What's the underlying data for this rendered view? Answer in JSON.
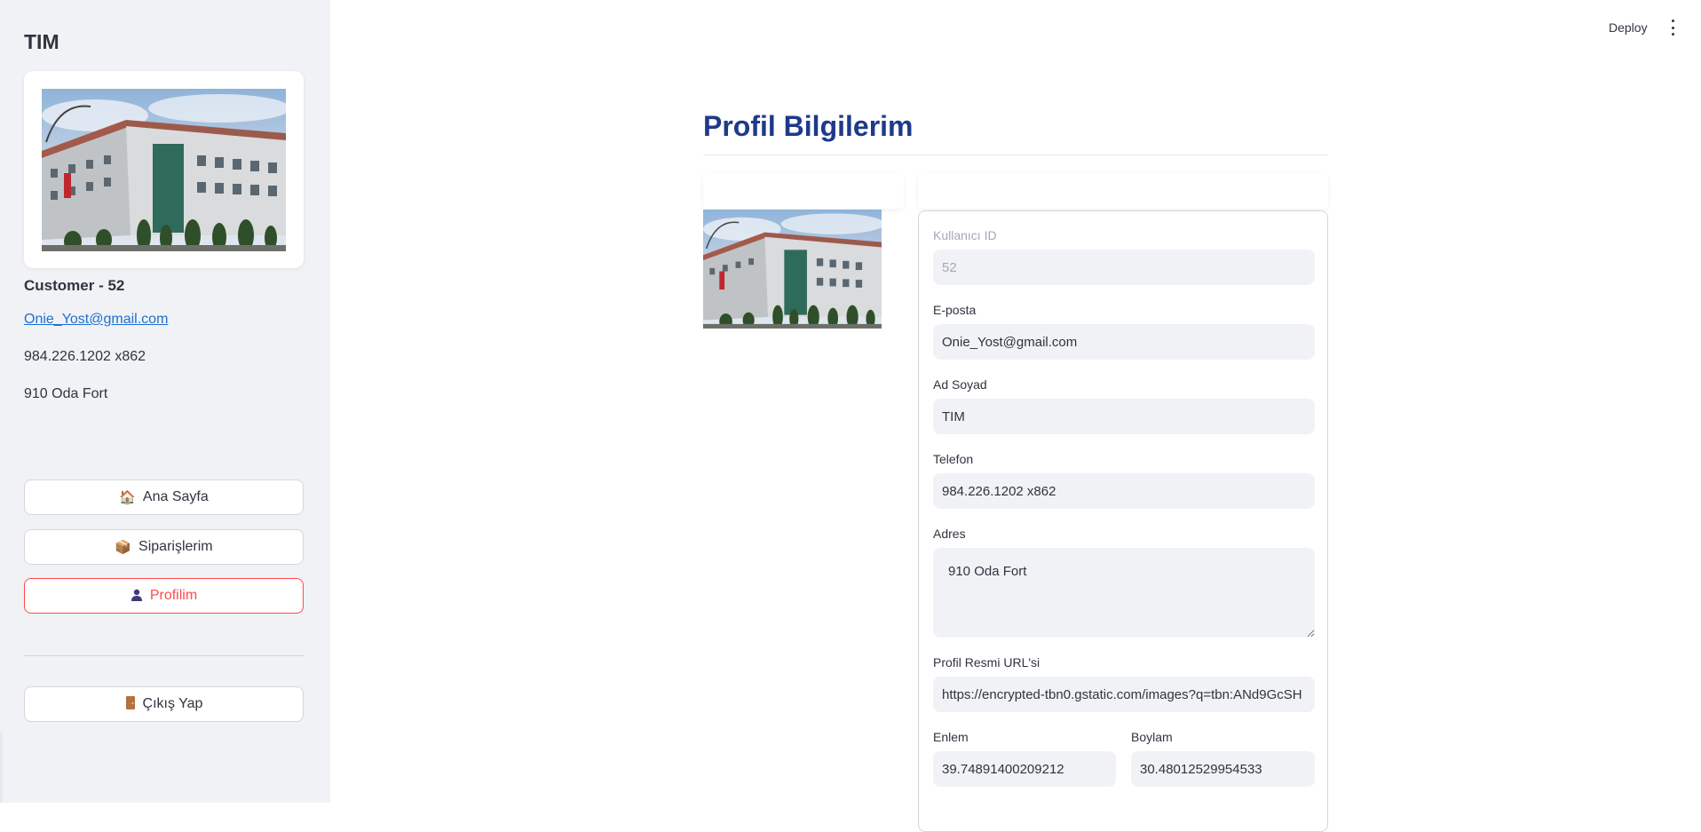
{
  "sidebar": {
    "title": "TIM",
    "customer_label": "Customer - 52",
    "email": "Onie_Yost@gmail.com",
    "phone": "984.226.1202 x862",
    "address": "910 Oda Fort",
    "buttons": [
      {
        "label": "Ana Sayfa",
        "icon": "house-icon"
      },
      {
        "label": "Siparişlerim",
        "icon": "package-icon"
      },
      {
        "label": "Profilim",
        "icon": "user-icon",
        "active": true
      }
    ],
    "logout": {
      "label": "Çıkış Yap",
      "icon": "door-icon"
    }
  },
  "header": {
    "deploy_label": "Deploy",
    "menu_icon": "vertical-dots-icon"
  },
  "main": {
    "title": "Profil Bilgilerim",
    "form": {
      "user_id": {
        "label": "Kullanıcı ID",
        "value": "52",
        "disabled": true
      },
      "email": {
        "label": "E-posta",
        "value": "Onie_Yost@gmail.com"
      },
      "full_name": {
        "label": "Ad Soyad",
        "value": "TIM"
      },
      "phone": {
        "label": "Telefon",
        "value": "984.226.1202 x862"
      },
      "address": {
        "label": "Adres",
        "value": "910 Oda Fort"
      },
      "photo_url": {
        "label": "Profil Resmi URL'si",
        "value": "https://encrypted-tbn0.gstatic.com/images?q=tbn:ANd9GcSH"
      },
      "latitude": {
        "label": "Enlem",
        "value": "39.74891400209212"
      },
      "longitude": {
        "label": "Boylam",
        "value": "30.48012529954533"
      }
    }
  },
  "colors": {
    "sidebar_bg": "#f0f2f6",
    "accent": "#ff4b4b",
    "title": "#1e3a8a",
    "link": "#1f6fd1"
  }
}
